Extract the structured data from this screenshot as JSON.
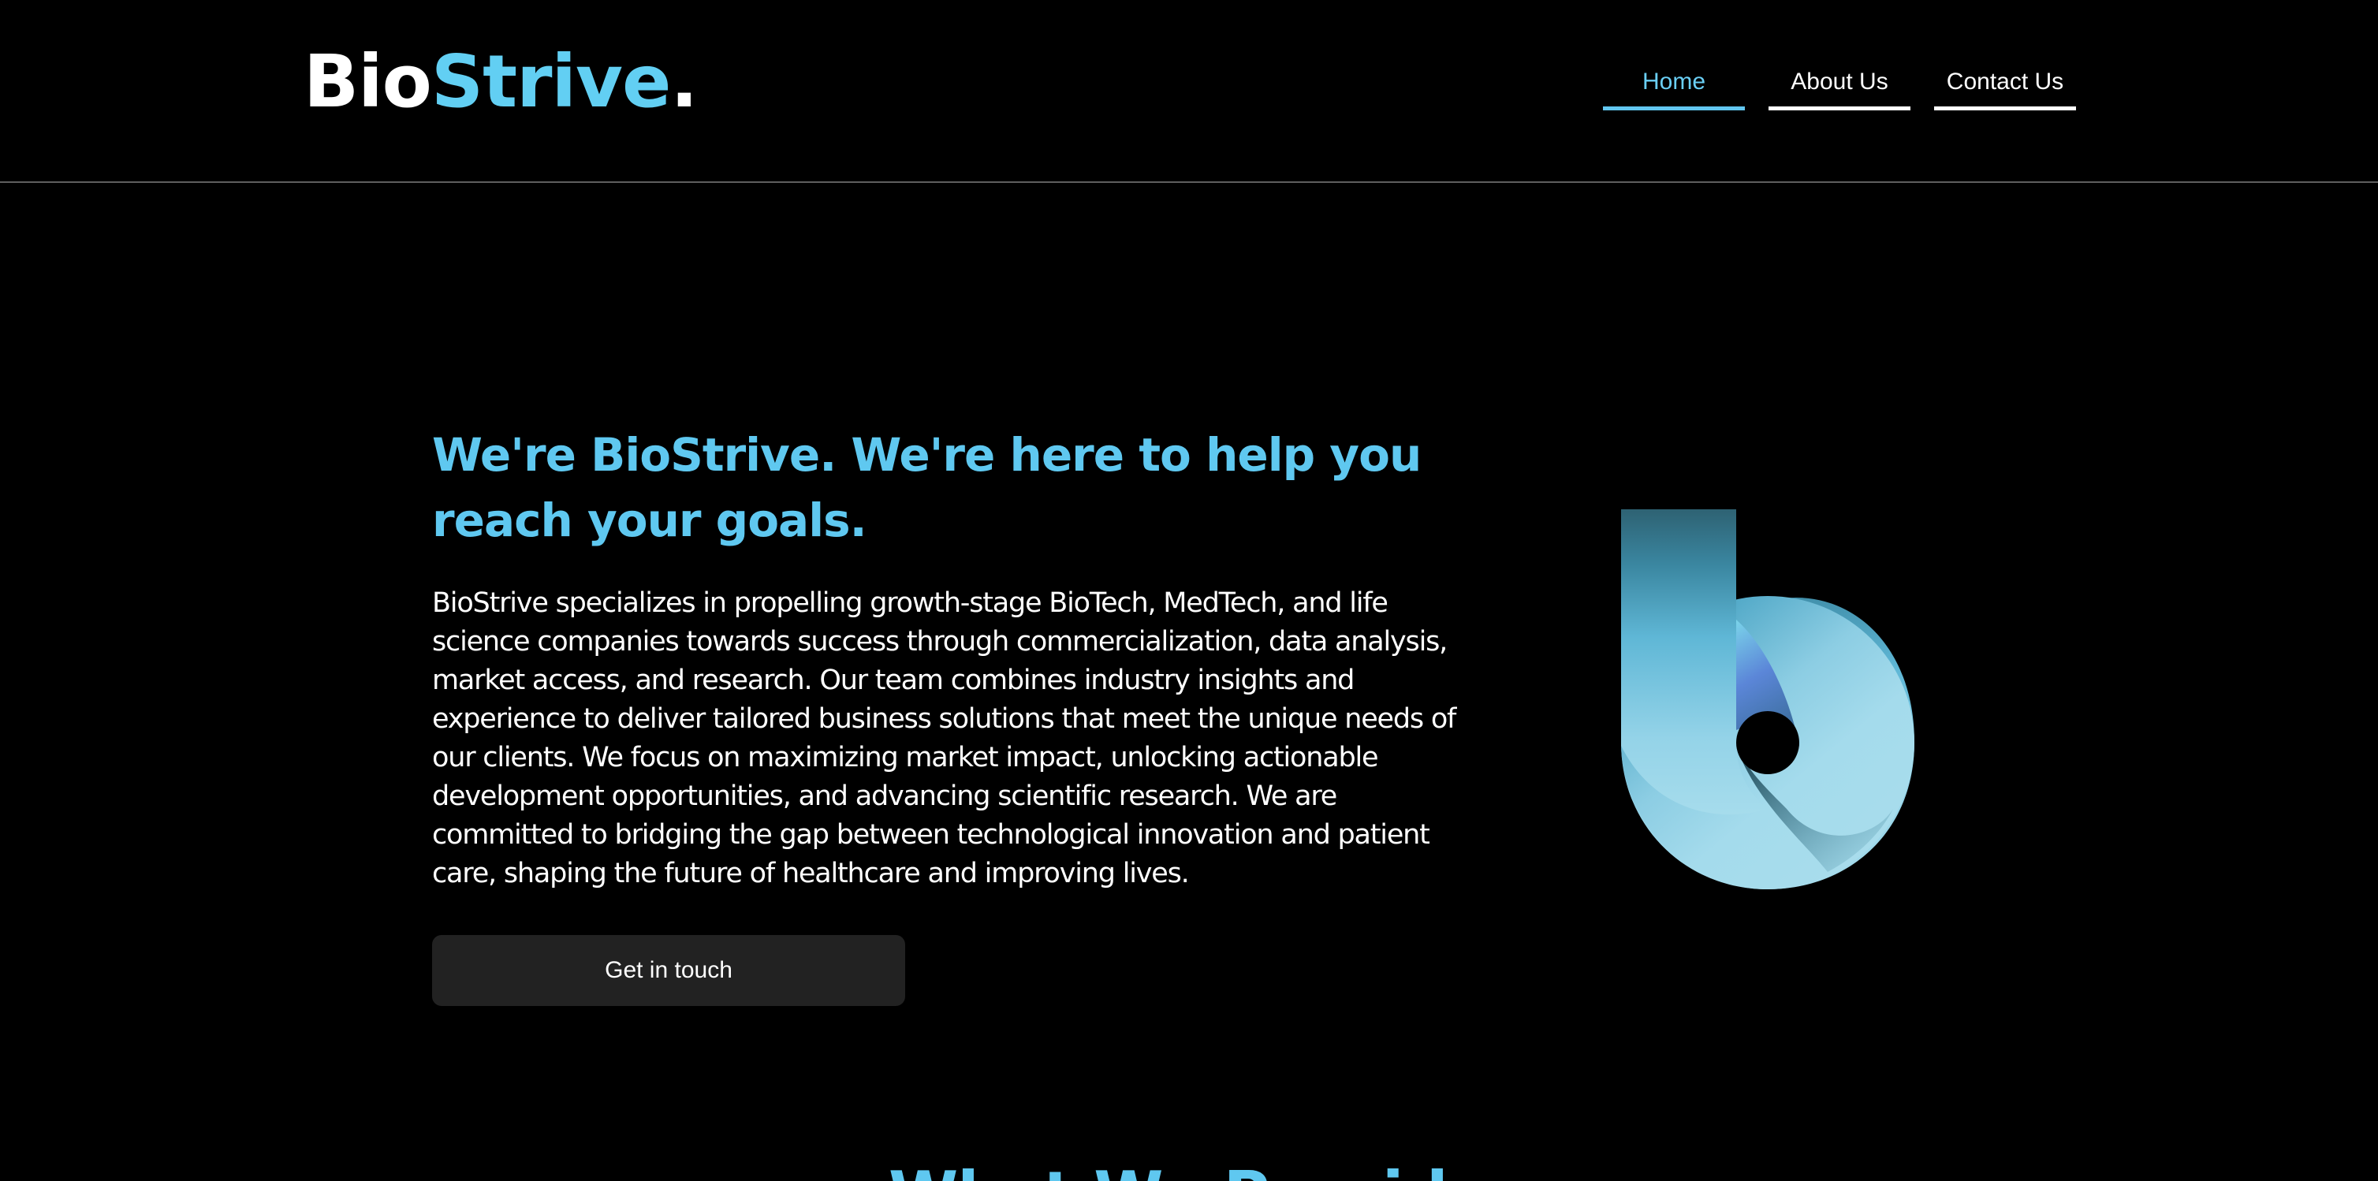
{
  "brand": {
    "name_part1": "Bio",
    "name_part2": "Strive",
    "name_dot": ".",
    "accent_color": "#62cff3",
    "logo_mark_icon": "letter-b-ribbon-icon"
  },
  "nav": {
    "items": [
      {
        "label": "Home",
        "active": true
      },
      {
        "label": "About Us",
        "active": false
      },
      {
        "label": "Contact Us",
        "active": false
      }
    ]
  },
  "hero": {
    "title": "We're BioStrive. We're here to help you reach your goals.",
    "body": "BioStrive specializes in propelling growth-stage BioTech, MedTech, and life science companies towards success through commercialization, data analysis, market access, and research. Our team combines industry insights and experience to deliver tailored business solutions that meet the unique needs of our clients. We focus on maximizing market impact, unlocking actionable development opportunities, and advancing scientific research. We are committed to bridging the gap between technological innovation and patient care, shaping the future of healthcare and improving lives.",
    "cta_label": "Get in touch"
  },
  "next_section": {
    "heading": "What We Provide"
  },
  "colors": {
    "background": "#000000",
    "heading_blue": "#5fc8f0",
    "button_bg": "#222222",
    "divider": "#5f5f5f"
  }
}
